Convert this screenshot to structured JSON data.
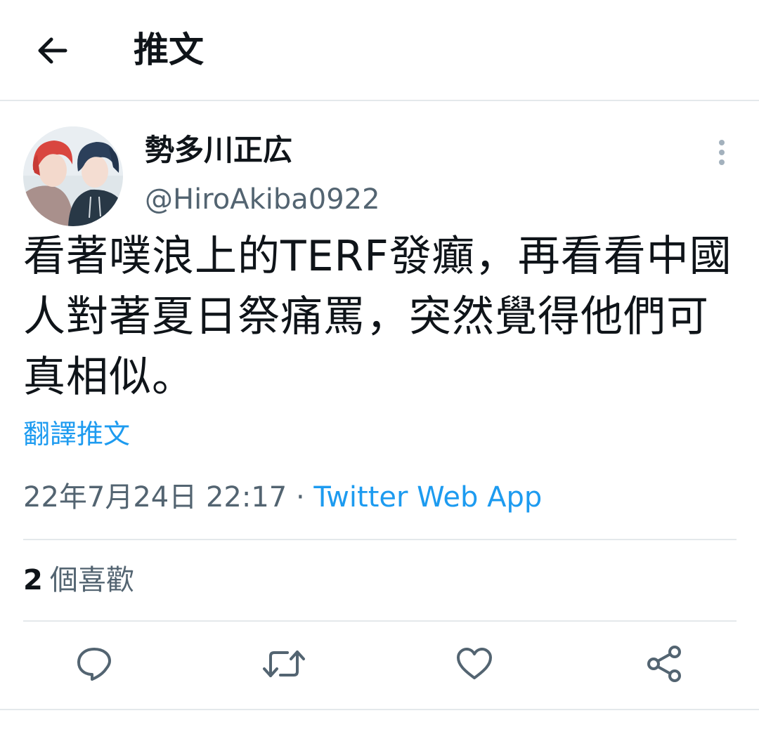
{
  "header": {
    "title": "推文",
    "back_icon": "arrow-left-icon"
  },
  "tweet": {
    "author": {
      "display_name": "勢多川正広",
      "handle": "@HiroAkiba0922",
      "avatar_icon": "avatar"
    },
    "text": "看著噗浪上的TERF發癲，再看看中國人對著夏日祭痛罵，突然覺得他們可真相似。",
    "translate_label": "翻譯推文",
    "date": "22年7月24日 22:17",
    "separator": "·",
    "source": "Twitter Web App",
    "likes_count": "2",
    "likes_label": "個喜歡"
  },
  "actions": {
    "icons": [
      "reply-icon",
      "retweet-icon",
      "like-icon",
      "share-icon"
    ]
  },
  "colors": {
    "accent": "#1d9bf0",
    "text_primary": "#0f1419",
    "text_secondary": "#536471",
    "divider": "#e4e8eb"
  }
}
